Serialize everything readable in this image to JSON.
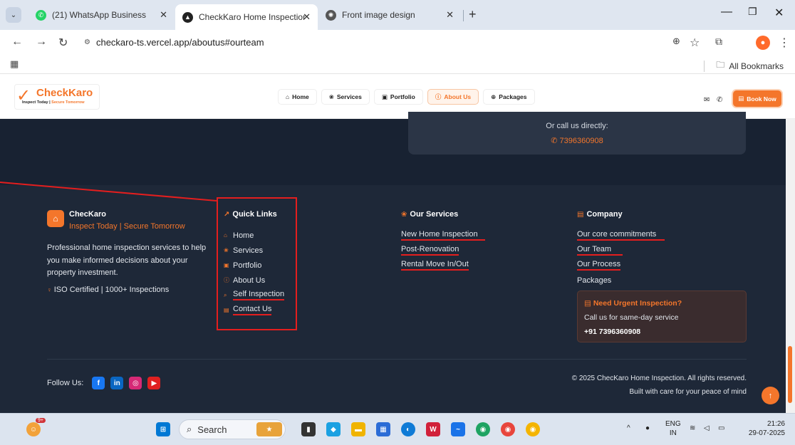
{
  "browser": {
    "tabs": [
      {
        "title": "(21) WhatsApp Business",
        "active": false
      },
      {
        "title": "CheckKaro Home Inspection - In",
        "active": true
      },
      {
        "title": "Front image design",
        "active": false
      }
    ],
    "url": "checkaro-ts.vercel.app/aboutus#ourteam",
    "bookmarks_label": "All Bookmarks"
  },
  "header": {
    "brand": "CheckKaro",
    "tagline_a": "Inspect Today | ",
    "tagline_b": "Secure Tomorrow",
    "nav": [
      {
        "label": "Home",
        "icon": "⌂"
      },
      {
        "label": "Services",
        "icon": "❀"
      },
      {
        "label": "Portfolio",
        "icon": "▣"
      },
      {
        "label": "About Us",
        "icon": "ⓘ"
      },
      {
        "label": "Packages",
        "icon": "⊕"
      }
    ],
    "book_label": "Book Now"
  },
  "cta": {
    "call_text": "Or call us directly:",
    "phone": "7396360908"
  },
  "footer": {
    "brand": "ChecKaro",
    "tagline": "Inspect Today | Secure Tomorrow",
    "description": "Professional home inspection services to help you make informed decisions about your property investment.",
    "certification": "ISO Certified | 1000+ Inspections",
    "quick_links": {
      "heading": "Quick Links",
      "items": [
        "Home",
        "Services",
        "Portfolio",
        "About Us",
        "Self Inspection",
        "Contact Us"
      ]
    },
    "services": {
      "heading": "Our Services",
      "items": [
        "New Home Inspection",
        "Post-Renovation",
        "Rental Move In/Out"
      ]
    },
    "company": {
      "heading": "Company",
      "items": [
        "Our core commitments",
        "Our Team",
        "Our Process",
        "Packages"
      ]
    },
    "urgent": {
      "title": "Need Urgent Inspection?",
      "subtitle": "Call us for same-day service",
      "phone": "+91 7396360908"
    },
    "follow_label": "Follow Us:",
    "copyright": "© 2025 ChecKaro Home Inspection. All rights reserved.",
    "built_with": "Built with care for your peace of mind"
  },
  "taskbar": {
    "search_label": "Search",
    "lang_a": "ENG",
    "lang_b": "IN",
    "time": "21:26",
    "date": "29-07-2025",
    "notification_badge": "9+"
  },
  "colors": {
    "accent": "#f4762b",
    "footer_bg": "#1e2838",
    "annotation": "#e41e1e"
  }
}
